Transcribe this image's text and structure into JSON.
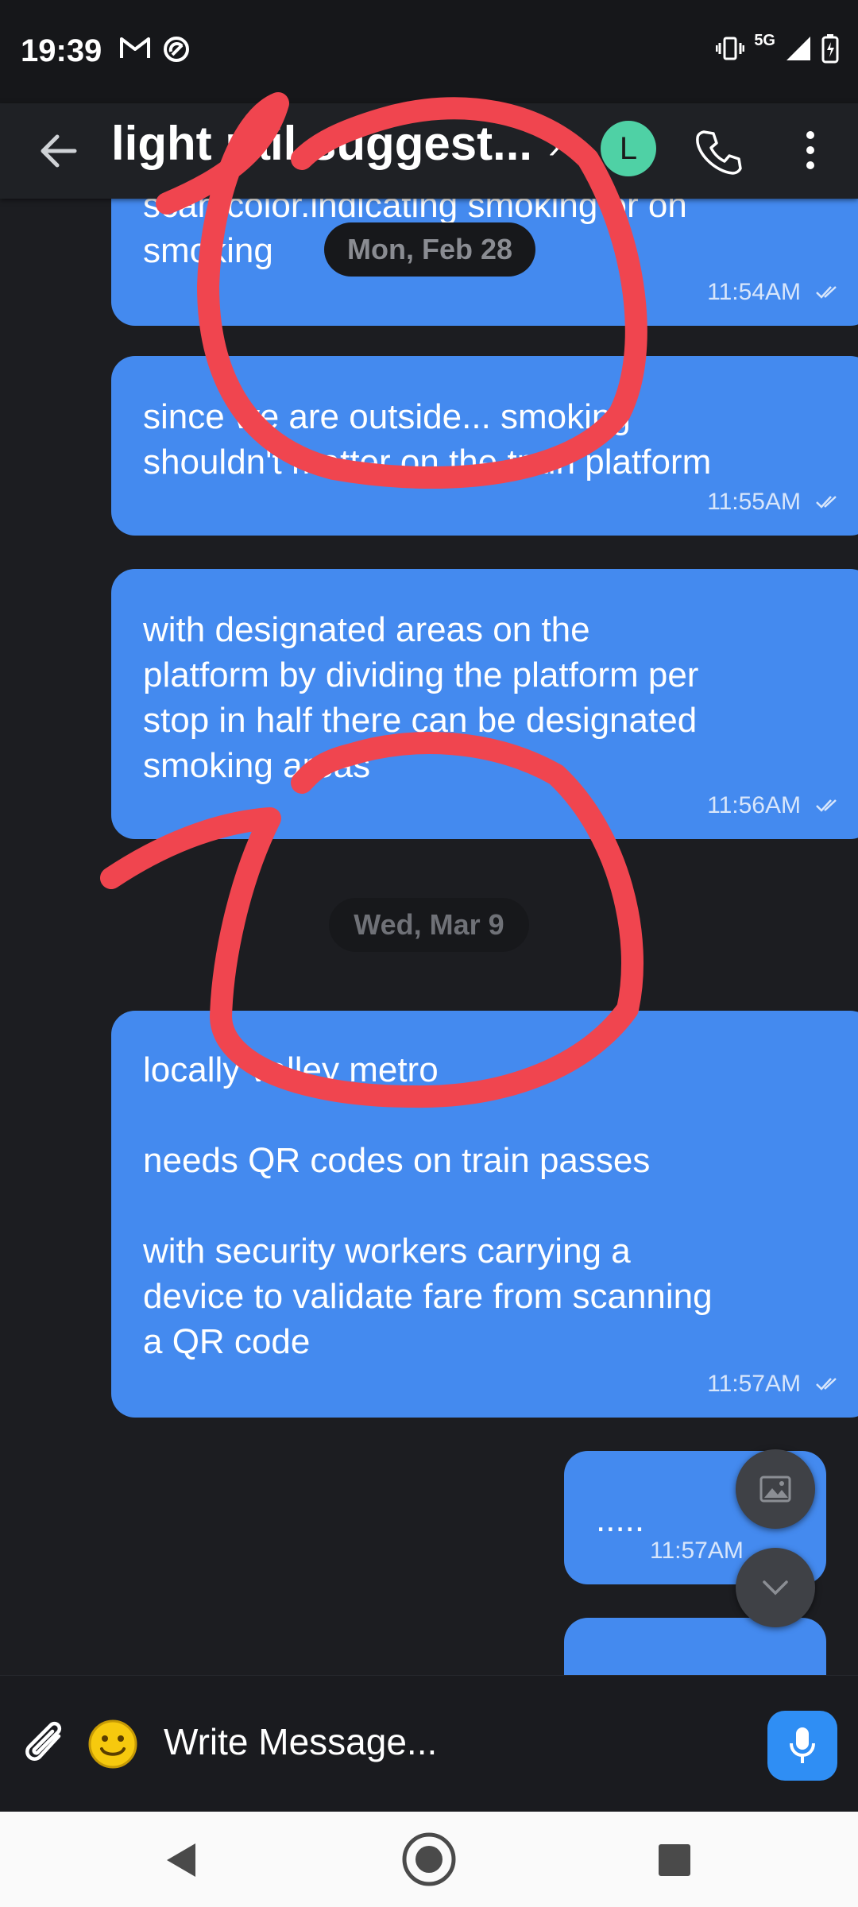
{
  "status_bar": {
    "time": "19:39",
    "network": "5G",
    "icons": [
      "gmail-icon",
      "sync-icon",
      "vibrate-icon",
      "signal-icon",
      "battery-icon"
    ]
  },
  "header": {
    "title": "light rail suggest...",
    "avatar_letter": "L",
    "avatar_color": "#4fd1a5"
  },
  "messages": [
    {
      "text": "scan color.indicating smoking or  on\nsmoking",
      "time": "11:54AM"
    },
    {
      "text": "since we are outside... smoking\nshouldn't matter on the train platform",
      "time": "11:55AM"
    },
    {
      "text": "with designated areas on the\nplatform by dividing the platform per\nstop in half there can be designated\nsmoking areas",
      "time": "11:56AM"
    },
    {
      "text": "locally valley metro\n\nneeds QR codes on train passes\n\nwith security workers carrying a\ndevice to validate fare from scanning\na QR code",
      "time": "11:57AM"
    },
    {
      "text": ".....",
      "time": "11:57AM"
    }
  ],
  "date_pills": [
    "Mon, Feb 28",
    "Wed, Mar 9"
  ],
  "composer": {
    "placeholder": "Write Message..."
  },
  "colors": {
    "bubble": "#448aef",
    "background": "#1c1d21",
    "annotation": "#f0454f",
    "mic": "#2f8ef4"
  }
}
